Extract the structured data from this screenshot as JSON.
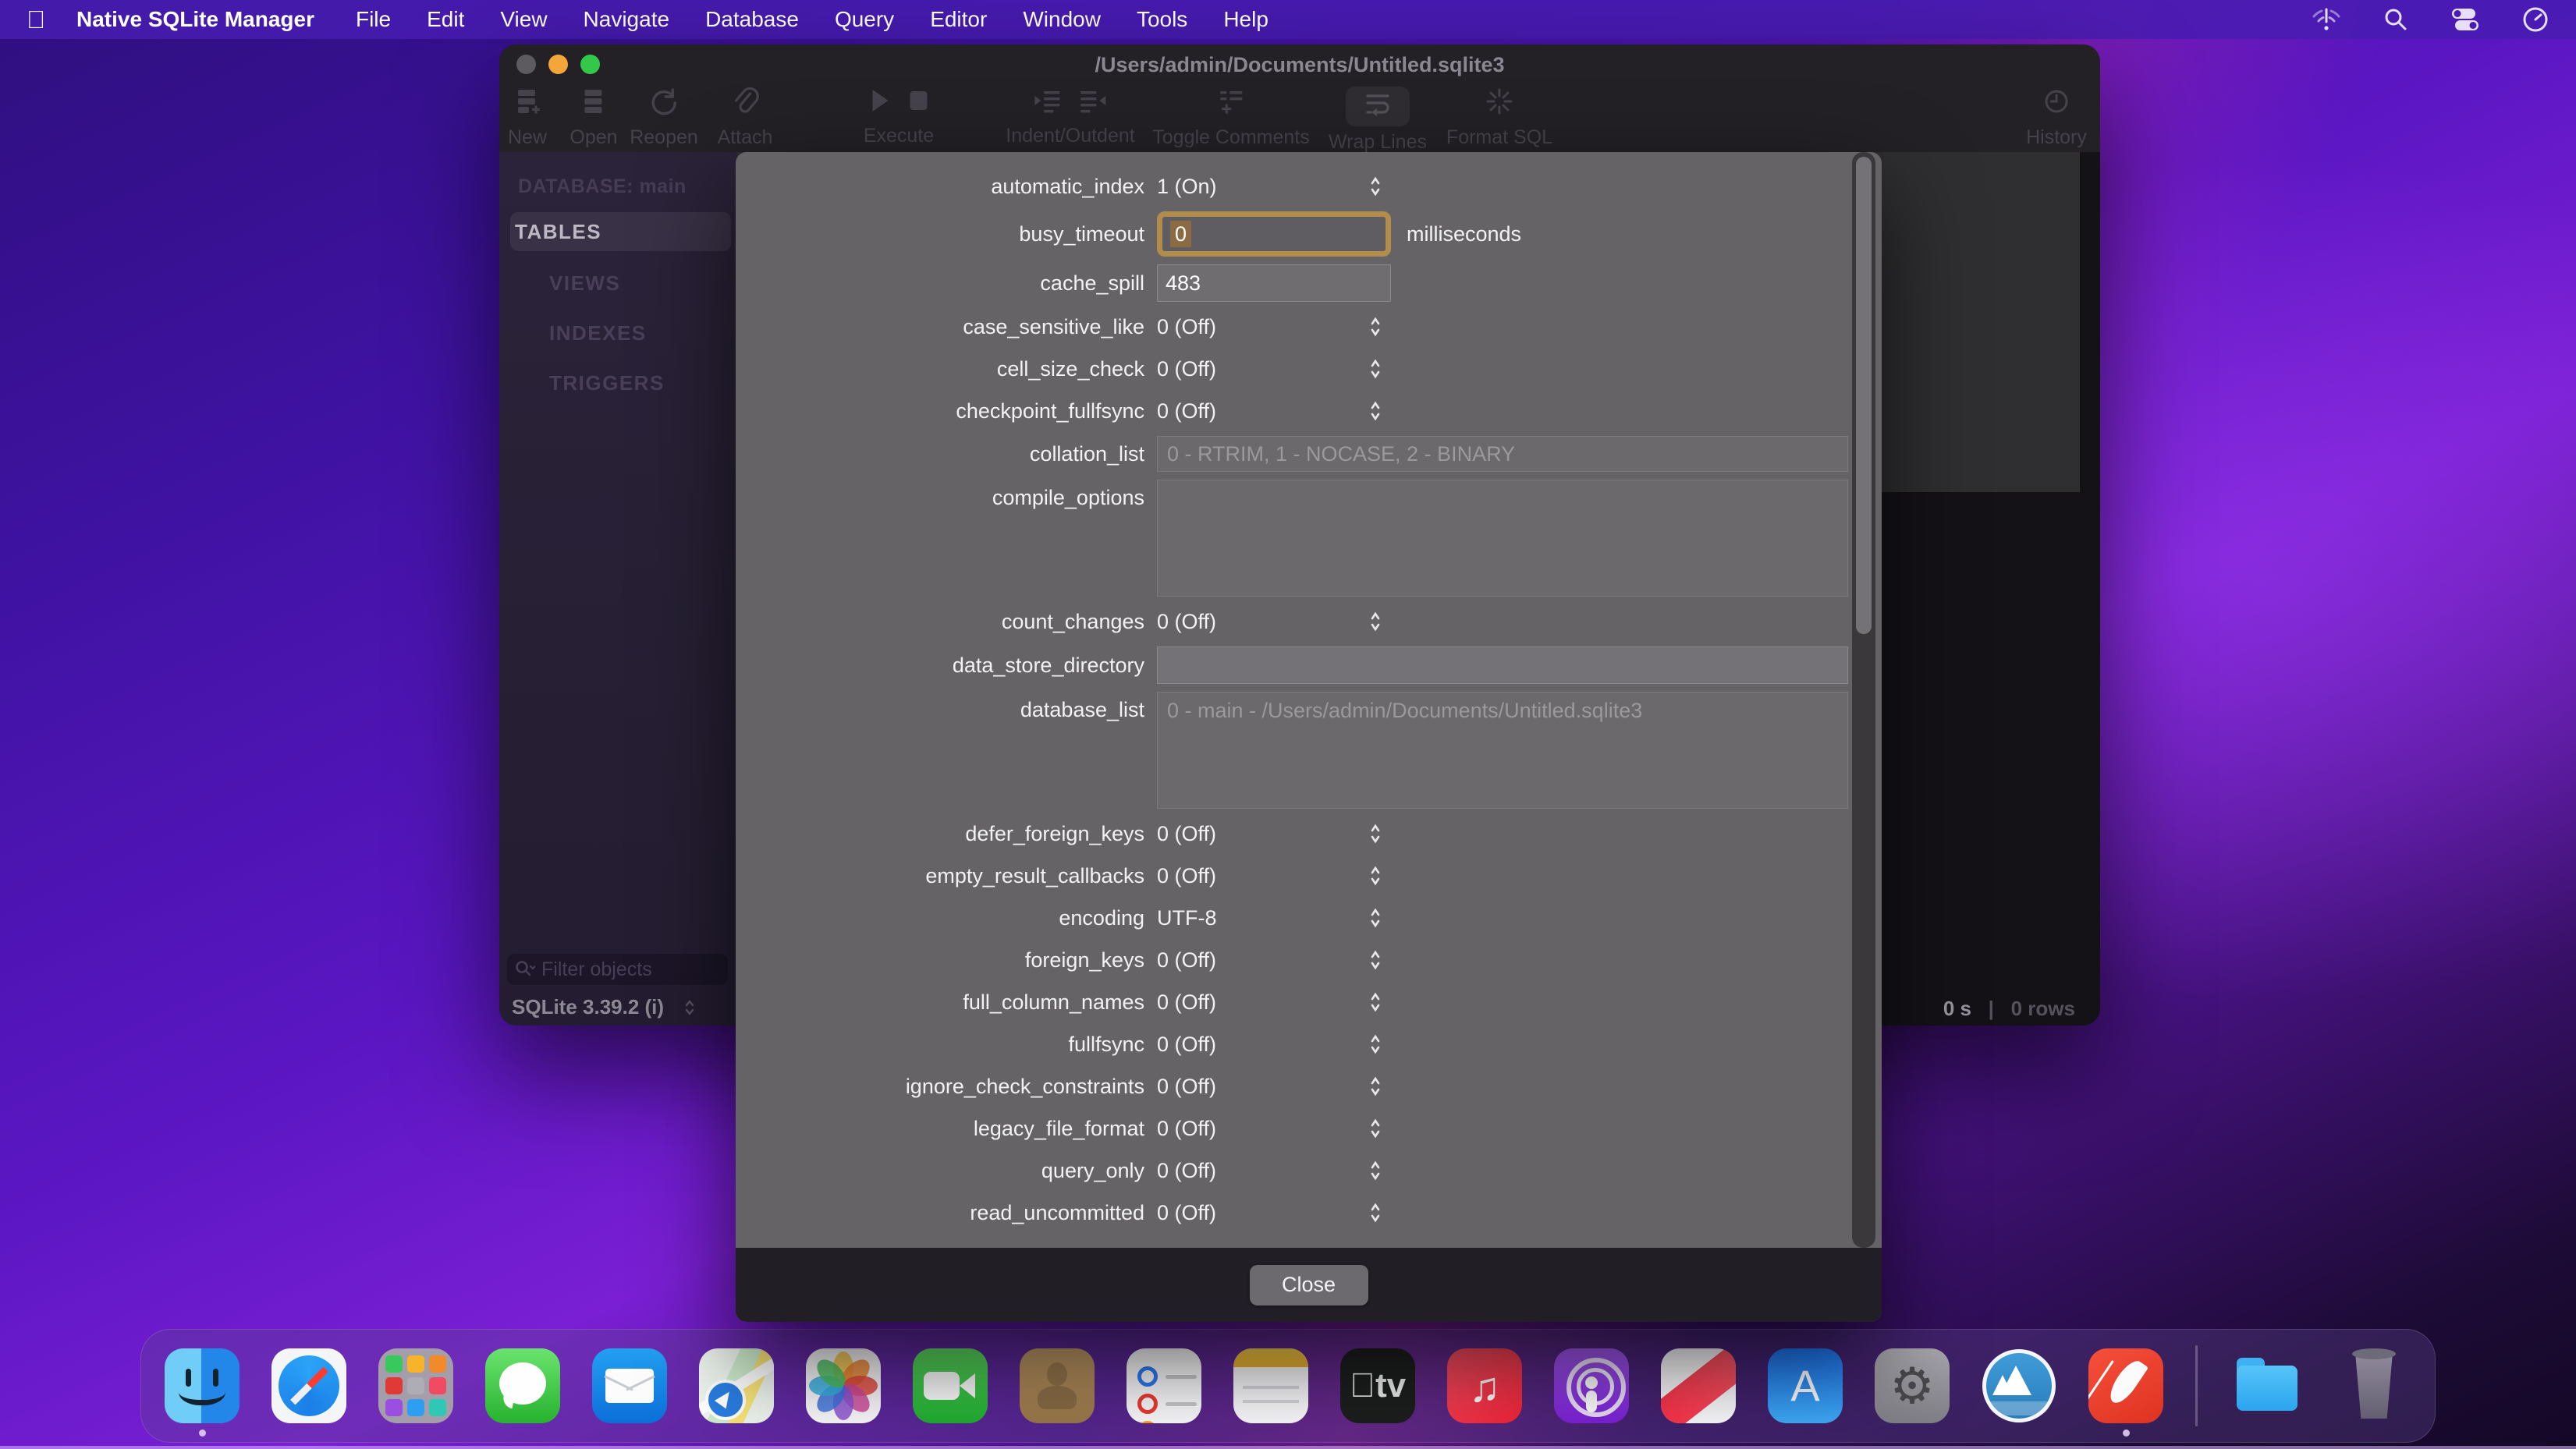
{
  "menubar": {
    "app_name": "Native SQLite Manager",
    "items": [
      "File",
      "Edit",
      "View",
      "Navigate",
      "Database",
      "Query",
      "Editor",
      "Window",
      "Tools",
      "Help"
    ],
    "status_icons": [
      "wifi-alert",
      "spotlight-search",
      "control-center",
      "clock"
    ]
  },
  "window": {
    "title": "/Users/admin/Documents/Untitled.sqlite3",
    "toolbar": {
      "new": "New",
      "open": "Open",
      "reopen": "Reopen",
      "attach": "Attach",
      "execute": "Execute",
      "indent_outdent": "Indent/Outdent",
      "toggle_comments": "Toggle Comments",
      "wrap_lines": "Wrap Lines",
      "format_sql": "Format SQL",
      "history": "History"
    },
    "sidebar": {
      "database_header": "DATABASE: main",
      "items": [
        {
          "label": "TABLES",
          "selected": true
        },
        {
          "label": "VIEWS",
          "selected": false
        },
        {
          "label": "INDEXES",
          "selected": false
        },
        {
          "label": "TRIGGERS",
          "selected": false
        }
      ],
      "filter_placeholder": "Filter objects",
      "version": "SQLite 3.39.2 (i)"
    },
    "statusbar": {
      "time": "0 s",
      "separator": "|",
      "rows": "0 rows"
    }
  },
  "dialog": {
    "rows": [
      {
        "label": "automatic_index",
        "value": "1 (On)",
        "control": "popup"
      },
      {
        "label": "busy_timeout",
        "value": "0",
        "control": "text-focused",
        "unit": "milliseconds"
      },
      {
        "label": "cache_spill",
        "value": "483",
        "control": "text"
      },
      {
        "label": "case_sensitive_like",
        "value": "0 (Off)",
        "control": "popup"
      },
      {
        "label": "cell_size_check",
        "value": "0 (Off)",
        "control": "popup"
      },
      {
        "label": "checkpoint_fullfsync",
        "value": "0 (Off)",
        "control": "popup"
      },
      {
        "label": "collation_list",
        "value": "0 - RTRIM, 1 - NOCASE, 2 - BINARY",
        "control": "readonly"
      },
      {
        "label": "compile_options",
        "value": "",
        "control": "textarea"
      },
      {
        "label": "count_changes",
        "value": "0 (Off)",
        "control": "popup"
      },
      {
        "label": "data_store_directory",
        "value": "",
        "control": "text-wide"
      },
      {
        "label": "database_list",
        "value": "0 - main - /Users/admin/Documents/Untitled.sqlite3",
        "control": "textarea"
      },
      {
        "label": "defer_foreign_keys",
        "value": "0 (Off)",
        "control": "popup"
      },
      {
        "label": "empty_result_callbacks",
        "value": "0 (Off)",
        "control": "popup"
      },
      {
        "label": "encoding",
        "value": "UTF-8",
        "control": "popup"
      },
      {
        "label": "foreign_keys",
        "value": "0 (Off)",
        "control": "popup"
      },
      {
        "label": "full_column_names",
        "value": "0 (Off)",
        "control": "popup"
      },
      {
        "label": "fullfsync",
        "value": "0 (Off)",
        "control": "popup"
      },
      {
        "label": "ignore_check_constraints",
        "value": "0 (Off)",
        "control": "popup"
      },
      {
        "label": "legacy_file_format",
        "value": "0 (Off)",
        "control": "popup"
      },
      {
        "label": "query_only",
        "value": "0 (Off)",
        "control": "popup"
      },
      {
        "label": "read_uncommitted",
        "value": "0 (Off)",
        "control": "popup"
      }
    ],
    "close_label": "Close"
  },
  "dock": {
    "icons": [
      "finder",
      "safari",
      "launchpad",
      "messages",
      "mail",
      "maps",
      "photos",
      "facetime",
      "contacts",
      "reminders",
      "notes",
      "tv",
      "music",
      "podcasts",
      "news",
      "app-store",
      "system-settings",
      "mountain-app",
      "native-sqlite-manager",
      "downloads-folder",
      "trash"
    ],
    "running": [
      "finder",
      "native-sqlite-manager"
    ]
  },
  "colors": {
    "focus_ring": "#b18c4b",
    "text_selection": "#8a6b42",
    "traffic_yellow": "#f3a63a",
    "traffic_green": "#34c84a",
    "dialog_bg": "#656366",
    "menubar_bg": "#481cb2"
  }
}
